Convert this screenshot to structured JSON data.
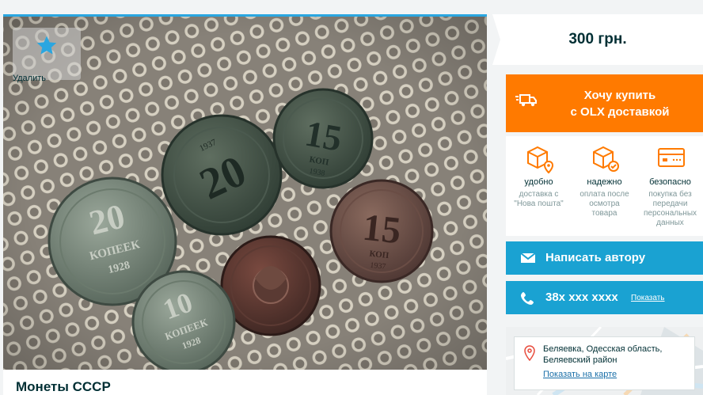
{
  "listing": {
    "title": "Монеты СССР",
    "favorite_label": "Удалить",
    "price": "300 грн."
  },
  "delivery": {
    "buy_line1": "Хочу купить",
    "buy_line2": "с OLX доставкой",
    "features": [
      {
        "title": "удобно",
        "desc": "доставка с \"Нова пошта\""
      },
      {
        "title": "надежно",
        "desc": "оплата после осмотра товара"
      },
      {
        "title": "безопасно",
        "desc": "покупка без передачи персональных данных"
      }
    ]
  },
  "contact": {
    "message_label": "Написать автору",
    "phone": "38x xxx xxxx",
    "show_label": "Показать"
  },
  "location": {
    "line1": "Беляевка, Одесская область,",
    "line2": "Беляевский район",
    "map_link": "Показать на карте"
  },
  "colors": {
    "accent_orange": "#ff7a00",
    "accent_blue": "#1aa2d2",
    "text_dark": "#002f34"
  },
  "coins": [
    {
      "value": "20",
      "word": "КОПЕЕК",
      "year": "1928"
    },
    {
      "value": "20",
      "word": "",
      "year": "1937"
    },
    {
      "value": "15",
      "word": "КОП",
      "year": "1938"
    },
    {
      "value": "15",
      "word": "КОП",
      "year": "1937"
    },
    {
      "value": "10",
      "word": "КОПЕЕК",
      "year": "1928"
    }
  ]
}
